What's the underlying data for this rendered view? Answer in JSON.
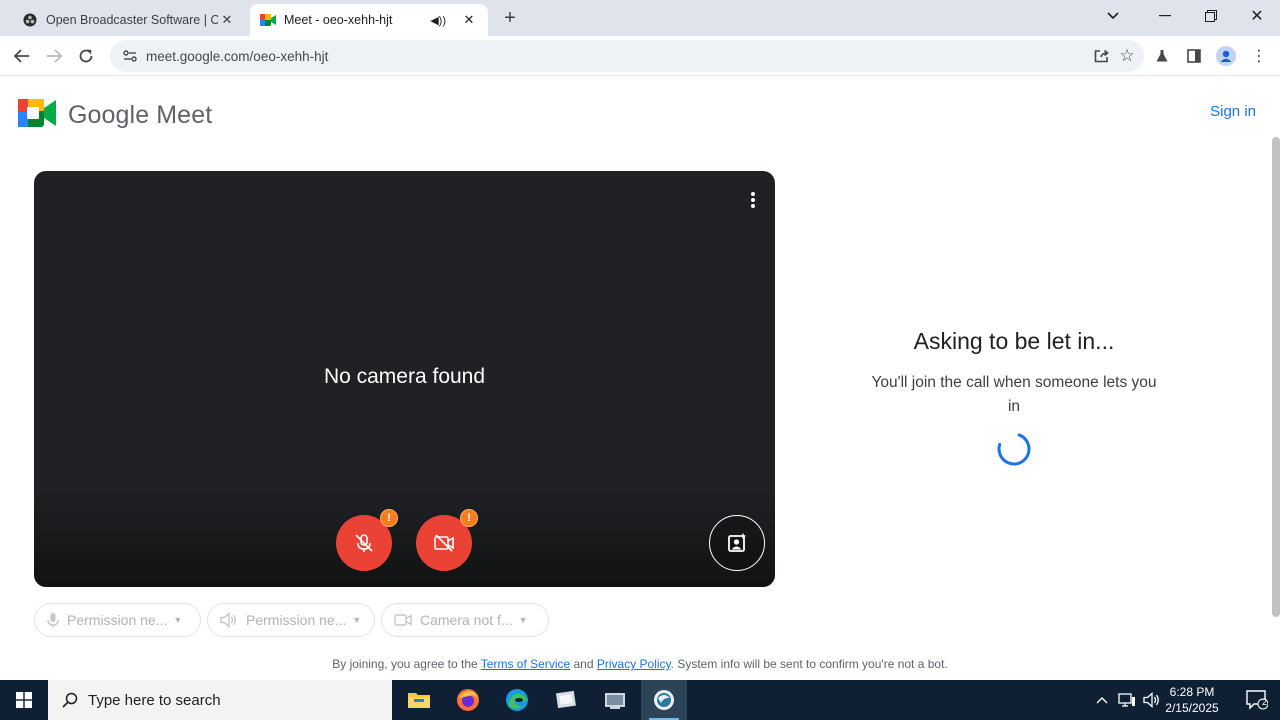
{
  "browser": {
    "tabs": [
      {
        "title": "Open Broadcaster Software | OB",
        "active": false
      },
      {
        "title": "Meet - oeo-xehh-hjt",
        "active": true
      }
    ],
    "url": "meet.google.com/oeo-xehh-hjt"
  },
  "meet": {
    "logo_text": "Google Meet",
    "sign_in": "Sign in",
    "no_camera": "No camera found",
    "warn_mark": "!",
    "controls": [
      {
        "label": "Permission ne...",
        "icon": "microphone-icon"
      },
      {
        "label": "Permission ne...",
        "icon": "speaker-icon"
      },
      {
        "label": "Camera not f...",
        "icon": "camera-icon"
      }
    ],
    "ask_title": "Asking to be let in...",
    "ask_sub": "You'll join the call when someone lets you in",
    "footer": {
      "pre": "By joining, you agree to the ",
      "terms": "Terms of Service",
      "and": " and ",
      "privacy": "Privacy Policy",
      "post": ". System info will be sent to confirm you're not a bot."
    },
    "colors": {
      "red": "#ea4335",
      "warn": "#fa7b17",
      "link": "#1a73e8",
      "video_bg": "#202124"
    }
  },
  "taskbar": {
    "search_placeholder": "Type here to search",
    "time": "6:28 PM",
    "date": "2/15/2025",
    "notification_count": "2",
    "apps": [
      "file-explorer-icon",
      "firefox-icon",
      "edge-icon",
      "app-icon",
      "app-icon",
      "obs-icon"
    ]
  }
}
